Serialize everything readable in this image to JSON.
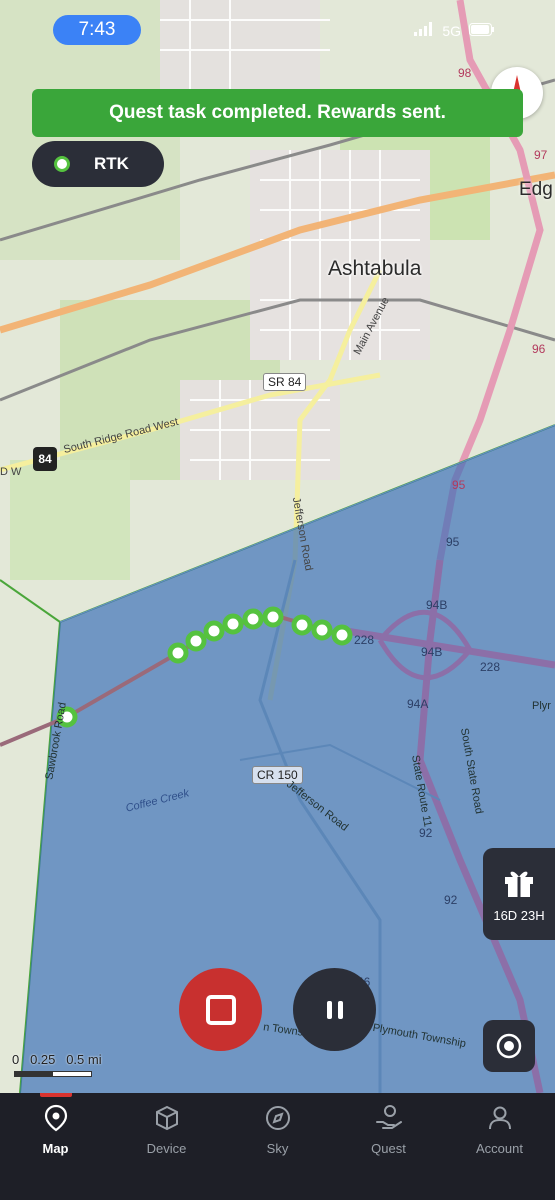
{
  "status_bar": {
    "time": "7:43",
    "network": "5G"
  },
  "toast": {
    "message": "Quest task completed. Rewards sent."
  },
  "rtk": {
    "label": "RTK"
  },
  "map": {
    "city": "Ashtabula",
    "edge_label": "Edg",
    "roads": {
      "main_avenue": "Main Avenue",
      "sr84": "SR 84",
      "south_ridge": "South Ridge Road West",
      "jefferson_road": "Jefferson Road",
      "jefferson_road_2": "Jefferson Road",
      "cr150": "CR 150",
      "coffee_creek": "Coffee Creek",
      "south_state_road": "South State Road",
      "state_route_11": "State Route 11",
      "sawbrook": "Sawbrook Road",
      "plymouth_left": "n Township",
      "plymouth_right": "Plymouth Township",
      "left_edge": "D W",
      "right_pl": "Plyr"
    },
    "shield_84": "84",
    "highway_numbers": [
      "98",
      "97",
      "96",
      "95",
      "95",
      "94B",
      "94B",
      "94A",
      "92",
      "92",
      "228",
      "228",
      "46"
    ]
  },
  "gift": {
    "countdown": "16D 23H"
  },
  "scale": {
    "labels": "0   0.25   0.5 mi"
  },
  "nav": {
    "items": [
      {
        "label": "Map",
        "icon": "map-pin-icon"
      },
      {
        "label": "Device",
        "icon": "cube-icon"
      },
      {
        "label": "Sky",
        "icon": "compass-icon"
      },
      {
        "label": "Quest",
        "icon": "quest-hand-icon"
      },
      {
        "label": "Account",
        "icon": "user-icon"
      }
    ]
  },
  "colors": {
    "toast_bg": "#3aa63a",
    "panel_bg": "#2b2e38",
    "stop_red": "#c8302f",
    "region_blue": "#3a6fb8",
    "track_green": "#55c23f",
    "nav_bg": "#1e1f27"
  }
}
